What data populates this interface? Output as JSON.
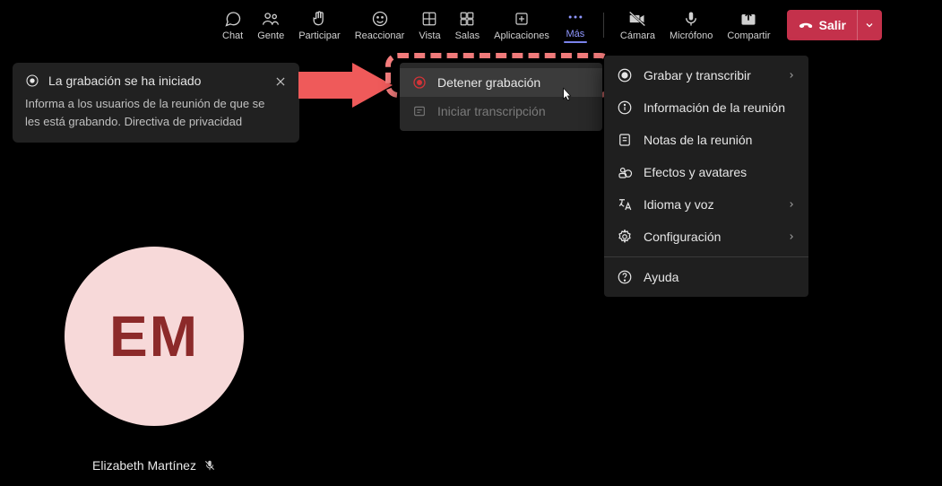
{
  "toolbar": {
    "chat": "Chat",
    "people": "Gente",
    "raise": "Participar",
    "react": "Reaccionar",
    "view": "Vista",
    "rooms": "Salas",
    "apps": "Aplicaciones",
    "more": "Más",
    "camera": "Cámara",
    "mic": "Micrófono",
    "share": "Compartir",
    "leave": "Salir"
  },
  "toast": {
    "title": "La grabación se ha iniciado",
    "body": "Informa a los usuarios de la reunión de que se les está grabando. Directiva de privacidad"
  },
  "submenu": {
    "stop": "Detener grabación",
    "transcribe": "Iniciar transcripción"
  },
  "moremenu": {
    "record": "Grabar y transcribir",
    "info": "Información de la reunión",
    "notes": "Notas de la reunión",
    "effects": "Efectos y avatares",
    "lang": "Idioma y voz",
    "settings": "Configuración",
    "help": "Ayuda"
  },
  "participant": {
    "initials": "EM",
    "name": "Elizabeth Martínez"
  }
}
